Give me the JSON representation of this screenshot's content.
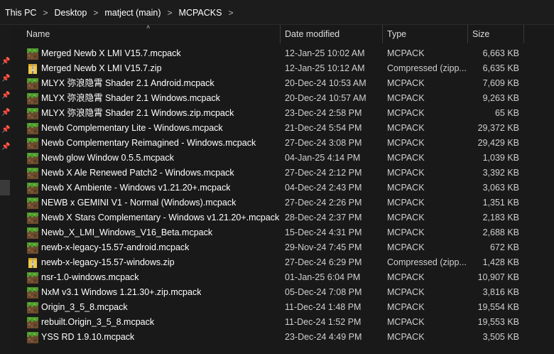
{
  "breadcrumb": [
    "This PC",
    "Desktop",
    "matject (main)",
    "MCPACKS"
  ],
  "columns": {
    "name": "Name",
    "date": "Date modified",
    "type": "Type",
    "size": "Size"
  },
  "files": [
    {
      "name": "Merged Newb X LMI V15.7.mcpack",
      "date": "12-Jan-25 10:02 AM",
      "type": "MCPACK",
      "size": "6,663 KB",
      "icon": "mcpack-icon"
    },
    {
      "name": "Merged Newb X LMI V15.7.zip",
      "date": "12-Jan-25 10:12 AM",
      "type": "Compressed (zipp...",
      "size": "6,635 KB",
      "icon": "zip-icon"
    },
    {
      "name": "MLYX 弥浪隐霄 Shader 2.1 Android.mcpack",
      "date": "20-Dec-24 10:53 AM",
      "type": "MCPACK",
      "size": "7,609 KB",
      "icon": "mcpack-icon"
    },
    {
      "name": "MLYX 弥浪隐霄 Shader 2.1 Windows.mcpack",
      "date": "20-Dec-24 10:57 AM",
      "type": "MCPACK",
      "size": "9,263 KB",
      "icon": "mcpack-icon"
    },
    {
      "name": "MLYX 弥浪隐霄 Shader 2.1 Windows.zip.mcpack",
      "date": "23-Dec-24 2:58 PM",
      "type": "MCPACK",
      "size": "65 KB",
      "icon": "mcpack-icon"
    },
    {
      "name": "Newb Complementary Lite - Windows.mcpack",
      "date": "21-Dec-24 5:54 PM",
      "type": "MCPACK",
      "size": "29,372 KB",
      "icon": "mcpack-icon"
    },
    {
      "name": "Newb Complementary Reimagined - Windows.mcpack",
      "date": "27-Dec-24 3:08 PM",
      "type": "MCPACK",
      "size": "29,429 KB",
      "icon": "mcpack-icon"
    },
    {
      "name": "Newb glow Window 0.5.5.mcpack",
      "date": "04-Jan-25 4:14 PM",
      "type": "MCPACK",
      "size": "1,039 KB",
      "icon": "mcpack-icon"
    },
    {
      "name": "Newb X Ale Renewed Patch2 - Windows.mcpack",
      "date": "27-Dec-24 2:12 PM",
      "type": "MCPACK",
      "size": "3,392 KB",
      "icon": "mcpack-icon"
    },
    {
      "name": "Newb X Ambiente - Windows v1.21.20+.mcpack",
      "date": "04-Dec-24 2:43 PM",
      "type": "MCPACK",
      "size": "3,063 KB",
      "icon": "mcpack-icon"
    },
    {
      "name": "NEWB x GEMINI V1 - Normal (Windows).mcpack",
      "date": "27-Dec-24 2:26 PM",
      "type": "MCPACK",
      "size": "1,351 KB",
      "icon": "mcpack-icon"
    },
    {
      "name": "Newb X Stars Complementary - Windows v1.21.20+.mcpack",
      "date": "28-Dec-24 2:37 PM",
      "type": "MCPACK",
      "size": "2,183 KB",
      "icon": "mcpack-icon"
    },
    {
      "name": "Newb_X_LMI_Windows_V16_Beta.mcpack",
      "date": "15-Dec-24 4:31 PM",
      "type": "MCPACK",
      "size": "2,688 KB",
      "icon": "mcpack-icon"
    },
    {
      "name": "newb-x-legacy-15.57-android.mcpack",
      "date": "29-Nov-24 7:45 PM",
      "type": "MCPACK",
      "size": "672 KB",
      "icon": "mcpack-icon"
    },
    {
      "name": "newb-x-legacy-15.57-windows.zip",
      "date": "27-Dec-24 6:29 PM",
      "type": "Compressed (zipp...",
      "size": "1,428 KB",
      "icon": "zip-icon"
    },
    {
      "name": "nsr-1.0-windows.mcpack",
      "date": "01-Jan-25 6:04 PM",
      "type": "MCPACK",
      "size": "10,907 KB",
      "icon": "mcpack-icon"
    },
    {
      "name": "NxM v3.1 Windows 1.21.30+.zip.mcpack",
      "date": "05-Dec-24 7:08 PM",
      "type": "MCPACK",
      "size": "3,816 KB",
      "icon": "mcpack-icon"
    },
    {
      "name": "Origin_3_5_8.mcpack",
      "date": "11-Dec-24 1:48 PM",
      "type": "MCPACK",
      "size": "19,554 KB",
      "icon": "mcpack-icon"
    },
    {
      "name": "rebuilt.Origin_3_5_8.mcpack",
      "date": "11-Dec-24 1:52 PM",
      "type": "MCPACK",
      "size": "19,553 KB",
      "icon": "mcpack-icon"
    },
    {
      "name": "YSS RD 1.9.10.mcpack",
      "date": "23-Dec-24 4:49 PM",
      "type": "MCPACK",
      "size": "3,505 KB",
      "icon": "mcpack-icon"
    }
  ]
}
